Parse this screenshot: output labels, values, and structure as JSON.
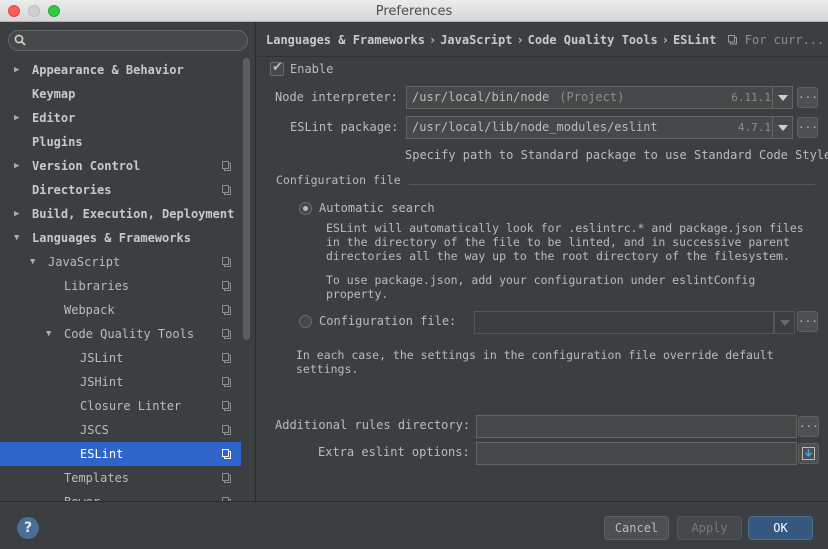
{
  "window": {
    "title": "Preferences"
  },
  "search": {
    "placeholder": ""
  },
  "sidebar": {
    "items": [
      {
        "label": "Appearance & Behavior",
        "bold": true,
        "arrow": "right",
        "indent": 0,
        "copy": false
      },
      {
        "label": "Keymap",
        "bold": true,
        "arrow": "",
        "indent": 0,
        "copy": false
      },
      {
        "label": "Editor",
        "bold": true,
        "arrow": "right",
        "indent": 0,
        "copy": false
      },
      {
        "label": "Plugins",
        "bold": true,
        "arrow": "",
        "indent": 0,
        "copy": false
      },
      {
        "label": "Version Control",
        "bold": true,
        "arrow": "right",
        "indent": 0,
        "copy": true
      },
      {
        "label": "Directories",
        "bold": true,
        "arrow": "",
        "indent": 0,
        "copy": true
      },
      {
        "label": "Build, Execution, Deployment",
        "bold": true,
        "arrow": "right",
        "indent": 0,
        "copy": false
      },
      {
        "label": "Languages & Frameworks",
        "bold": true,
        "arrow": "down",
        "indent": 0,
        "copy": false
      },
      {
        "label": "JavaScript",
        "bold": false,
        "arrow": "down",
        "indent": 1,
        "copy": true
      },
      {
        "label": "Libraries",
        "bold": false,
        "arrow": "",
        "indent": 2,
        "copy": true
      },
      {
        "label": "Webpack",
        "bold": false,
        "arrow": "",
        "indent": 2,
        "copy": true
      },
      {
        "label": "Code Quality Tools",
        "bold": false,
        "arrow": "down",
        "indent": 2,
        "copy": true
      },
      {
        "label": "JSLint",
        "bold": false,
        "arrow": "",
        "indent": 3,
        "copy": true
      },
      {
        "label": "JSHint",
        "bold": false,
        "arrow": "",
        "indent": 3,
        "copy": true
      },
      {
        "label": "Closure Linter",
        "bold": false,
        "arrow": "",
        "indent": 3,
        "copy": true
      },
      {
        "label": "JSCS",
        "bold": false,
        "arrow": "",
        "indent": 3,
        "copy": true
      },
      {
        "label": "ESLint",
        "bold": false,
        "arrow": "",
        "indent": 3,
        "copy": true,
        "selected": true
      },
      {
        "label": "Templates",
        "bold": false,
        "arrow": "",
        "indent": 2,
        "copy": true
      },
      {
        "label": "Bower",
        "bold": false,
        "arrow": "",
        "indent": 2,
        "copy": true
      }
    ]
  },
  "breadcrumb": {
    "parts": [
      "Languages & Frameworks",
      "JavaScript",
      "Code Quality Tools",
      "ESLint"
    ],
    "separator": "›",
    "scope": "For curr..."
  },
  "form": {
    "enable_label": "Enable",
    "enable_checked": true,
    "node_label": "Node interpreter:",
    "node_value": "/usr/local/bin/node",
    "node_hint": "(Project)",
    "node_version": "6.11.1",
    "pkg_label": "ESLint package:",
    "pkg_value": "/usr/local/lib/node_modules/eslint",
    "pkg_version": "4.7.1",
    "pkg_help": "Specify path to Standard package to use Standard Code Style",
    "config_section": "Configuration file",
    "auto_search_label": "Automatic search",
    "auto_search_selected": true,
    "auto_desc": "ESLint will automatically look for .eslintrc.* and package.json files\nin the directory of the file to be linted, and in successive parent\ndirectories all the way up to the root directory of the filesystem.",
    "auto_desc2": "To use package.json, add your configuration under eslintConfig\nproperty.",
    "config_file_label": "Configuration file:",
    "config_file_value": "",
    "config_note": "In each case, the settings in the configuration file override default\nsettings.",
    "rules_label": "Additional rules directory:",
    "rules_value": "",
    "extra_label": "Extra eslint options:",
    "extra_value": "",
    "dots": "..."
  },
  "footer": {
    "help": "?",
    "cancel": "Cancel",
    "apply": "Apply",
    "ok": "OK"
  },
  "colors": {
    "selection": "#2f65ca",
    "background": "#3c3f41",
    "primary_button": "#365880"
  }
}
